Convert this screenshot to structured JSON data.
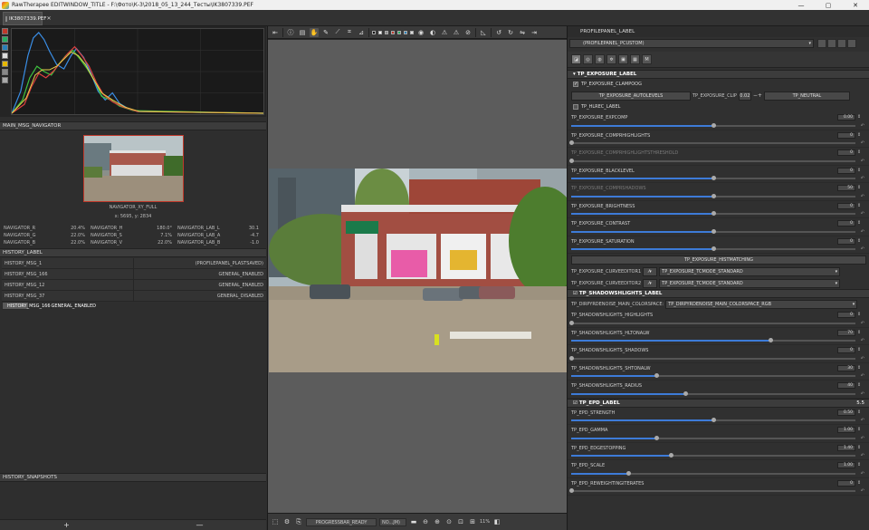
{
  "window": {
    "title": "RawTherapee EDITWINDOW_TITLE - F:\\Фото\\К-3\\2018_05_13_244_Тесты\\IK3807339.PEF",
    "min": "—",
    "max": "▢",
    "close": "✕"
  },
  "tab": {
    "label": "IK3807339.PEF",
    "close": "✕"
  },
  "navigator": {
    "header": "MAIN_MSG_NAVIGATOR",
    "xy_label": "NAVIGATOR_XY_FULL",
    "coords": "x: 5695, y: 2834",
    "rows": [
      [
        {
          "k": "NAVIGATOR_R",
          "v": "20.4%"
        },
        {
          "k": "NAVIGATOR_H",
          "v": "180.0°"
        },
        {
          "k": "NAVIGATOR_LAB_L",
          "v": "30.1"
        }
      ],
      [
        {
          "k": "NAVIGATOR_G",
          "v": "22.0%"
        },
        {
          "k": "NAVIGATOR_S",
          "v": "7.1%"
        },
        {
          "k": "NAVIGATOR_LAB_A",
          "v": "-4.7"
        }
      ],
      [
        {
          "k": "NAVIGATOR_B",
          "v": "22.0%"
        },
        {
          "k": "NAVIGATOR_V",
          "v": "22.0%"
        },
        {
          "k": "NAVIGATOR_LAB_B",
          "v": "-1.0"
        }
      ]
    ]
  },
  "history": {
    "header": "HISTORY_LABEL",
    "rows": [
      {
        "a": "HISTORY_MSG_1",
        "b": "(PROFILEPANEL_PLASTSAVED)"
      },
      {
        "a": "HISTORY_MSG_166",
        "b": "GENERAL_ENABLED"
      },
      {
        "a": "HISTORY_MSG_12",
        "b": "GENERAL_ENABLED"
      },
      {
        "a": "HISTORY_MSG_37",
        "b": "GENERAL_DISABLED"
      },
      {
        "a": "HISTORY_MSG_166",
        "b": "GENERAL_ENABLED"
      }
    ]
  },
  "snapshots": {
    "header": "HISTORY_SNAPSHOTS",
    "add": "+",
    "remove": "—"
  },
  "statusbar": {
    "progress": "PROGRESSBAR_READY",
    "profile_select": "NO...JM)",
    "zoom": "11%"
  },
  "profile": {
    "header": "PROFILEPANEL_LABEL",
    "combo": "(PROFILEPANEL_PCUSTOM)"
  },
  "exposure": {
    "header": "TP_EXPOSURE_LABEL",
    "clampoog": "TP_EXPOSURE_CLAMPOOG",
    "autolevels": "TP_EXPOSURE_AUTOLEVELS",
    "clip_label": "TP_EXPOSURE_CLIP",
    "clip_value": "0.02",
    "neutral": "TP_NEUTRAL",
    "hlrec": "TP_HLREC_LABEL",
    "sliders": [
      {
        "label": "TP_EXPOSURE_EXPCOMP",
        "value": "0.00",
        "pos": 0.5,
        "dis": false
      },
      {
        "label": "TP_EXPOSURE_COMPRHIGHLIGHTS",
        "value": "0",
        "pos": 0,
        "dis": false
      },
      {
        "label": "TP_EXPOSURE_COMPRHIGHLIGHTSTHRESHOLD",
        "value": "0",
        "pos": 0,
        "dis": true
      },
      {
        "label": "TP_EXPOSURE_BLACKLEVEL",
        "value": "0",
        "pos": 0.5,
        "dis": false
      },
      {
        "label": "TP_EXPOSURE_COMPRSHADOWS",
        "value": "50",
        "pos": 0.5,
        "dis": true
      },
      {
        "label": "TP_EXPOSURE_BRIGHTNESS",
        "value": "0",
        "pos": 0.5,
        "dis": false
      },
      {
        "label": "TP_EXPOSURE_CONTRAST",
        "value": "0",
        "pos": 0.5,
        "dis": false
      },
      {
        "label": "TP_EXPOSURE_SATURATION",
        "value": "0",
        "pos": 0.5,
        "dis": false
      }
    ],
    "histmatching": "TP_EXPOSURE_HISTMATCHING",
    "curve1_label": "TP_EXPOSURE_CURVEEDITOR1",
    "curve2_label": "TP_EXPOSURE_CURVEEDITOR2",
    "curve1_mode": "TP_EXPOSURE_TCMODE_STANDARD",
    "curve2_mode": "TP_EXPOSURE_TCMODE_STANDARD"
  },
  "shadows": {
    "header": "TP_SHADOWSHLIGHTS_LABEL",
    "colorspace_label": "TP_DIRPYRDENOISE_MAIN_COLORSPACE:",
    "colorspace_value": "TP_DIRPYRDENOISE_MAIN_COLORSPACE_RGB",
    "sliders": [
      {
        "label": "TP_SHADOWSHLIGHTS_HIGHLIGHTS",
        "value": "0",
        "pos": 0,
        "dis": false
      },
      {
        "label": "TP_SHADOWSHLIGHTS_HLTONALW",
        "value": "70",
        "pos": 0.7,
        "dis": false
      },
      {
        "label": "TP_SHADOWSHLIGHTS_SHADOWS",
        "value": "0",
        "pos": 0,
        "dis": false
      },
      {
        "label": "TP_SHADOWSHLIGHTS_SHTONALW",
        "value": "30",
        "pos": 0.3,
        "dis": false
      },
      {
        "label": "TP_SHADOWSHLIGHTS_RADIUS",
        "value": "40",
        "pos": 0.4,
        "dis": false
      }
    ]
  },
  "epd": {
    "header": "TP_EPD_LABEL",
    "rt": "5.5",
    "sliders": [
      {
        "label": "TP_EPD_STRENGTH",
        "value": "0.50",
        "pos": 0.5,
        "dis": false
      },
      {
        "label": "TP_EPD_GAMMA",
        "value": "1.00",
        "pos": 0.3,
        "dis": false
      },
      {
        "label": "TP_EPD_EDGESTOPPING",
        "value": "1.40",
        "pos": 0.35,
        "dis": false
      },
      {
        "label": "TP_EPD_SCALE",
        "value": "1.00",
        "pos": 0.2,
        "dis": false
      },
      {
        "label": "TP_EPD_REWEIGHTINGITERATES",
        "value": "0",
        "pos": 0,
        "dis": false
      }
    ]
  },
  "colors": {
    "accent": "#3d7bd8",
    "panel": "#303030"
  }
}
